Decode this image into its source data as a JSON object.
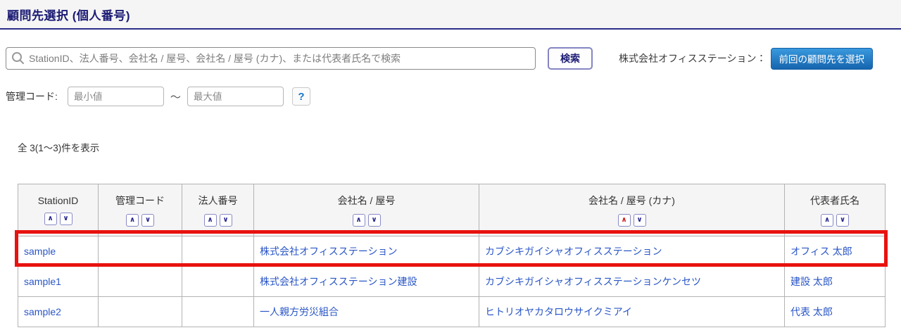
{
  "page": {
    "title": "顧問先選択 (個人番号)"
  },
  "search": {
    "placeholder": "StationID、法人番号、会社名 / 屋号、会社名 / 屋号 (カナ)、または代表者氏名で検索",
    "button_label": "検索",
    "client_label": "株式会社オフィスステーション：",
    "previous_client_button": "前回の顧問先を選択"
  },
  "filter": {
    "label": "管理コード:",
    "min_placeholder": "最小値",
    "separator": "～",
    "max_placeholder": "最大値",
    "help_label": "?"
  },
  "results": {
    "count_text": "全 3(1〜3)件を表示"
  },
  "icons": {
    "sort_up": "∧",
    "sort_down": "∨",
    "search": "magnifier"
  },
  "table": {
    "columns": [
      {
        "label": "StationID",
        "sort_active": "none"
      },
      {
        "label": "管理コード",
        "sort_active": "none"
      },
      {
        "label": "法人番号",
        "sort_active": "none"
      },
      {
        "label": "会社名 / 屋号",
        "sort_active": "none"
      },
      {
        "label": "会社名 / 屋号 (カナ)",
        "sort_active": "asc"
      },
      {
        "label": "代表者氏名",
        "sort_active": "none"
      }
    ],
    "rows": [
      {
        "station_id": "sample",
        "admin_code": "",
        "corporate_number": "",
        "company_name": "株式会社オフィスステーション",
        "company_kana": "カブシキガイシャオフィスステーション",
        "representative": "オフィス 太郎",
        "highlighted": true
      },
      {
        "station_id": "sample1",
        "admin_code": "",
        "corporate_number": "",
        "company_name": "株式会社オフィスステーション建設",
        "company_kana": "カブシキガイシャオフィスステーションケンセツ",
        "representative": "建設 太郎",
        "highlighted": false
      },
      {
        "station_id": "sample2",
        "admin_code": "",
        "corporate_number": "",
        "company_name": "一人親方労災組合",
        "company_kana": "ヒトリオヤカタロウサイクミアイ",
        "representative": "代表 太郎",
        "highlighted": false
      }
    ]
  },
  "colors": {
    "title_navy": "#1b1b74",
    "title_underline": "#2d2d86",
    "link_blue": "#2a56c6",
    "primary_button_top": "#3a99de",
    "primary_button_bottom": "#1565ae",
    "sort_active_red": "#cc1414",
    "highlight_red": "#e8120f",
    "header_gray": "#f5f5f5",
    "table_border": "#b3b3b3"
  }
}
